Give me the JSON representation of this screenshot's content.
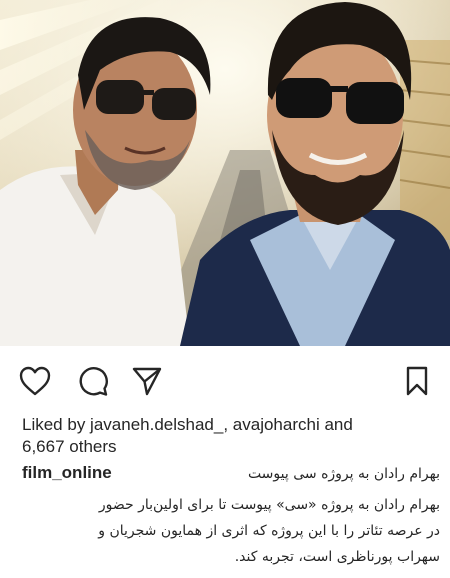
{
  "post": {
    "photo_alt": "Two men wearing sunglasses taking a selfie"
  },
  "actions": {
    "like_icon": "heart-icon",
    "comment_icon": "comment-bubble-icon",
    "share_icon": "paper-plane-icon",
    "save_icon": "bookmark-icon"
  },
  "likes": {
    "prefix": "Liked by ",
    "user1": "javaneh.delshad_",
    "separator": ", ",
    "user2": "avajoharchi",
    "joiner": " and",
    "count": "6,667 others"
  },
  "caption": {
    "username": "film_online",
    "headline": "بهرام رادان به پروژه سی پیوست",
    "lines": [
      "بهرام رادان به پروژه «سی» پیوست تا برای اولین‌بار حضور",
      "در عرصه تئاتر را با این پروژه که اثری از همایون شجریان و",
      "سهراب پورناظری است، تجربه کند."
    ]
  },
  "colors": {
    "text": "#262626",
    "background": "#ffffff"
  }
}
